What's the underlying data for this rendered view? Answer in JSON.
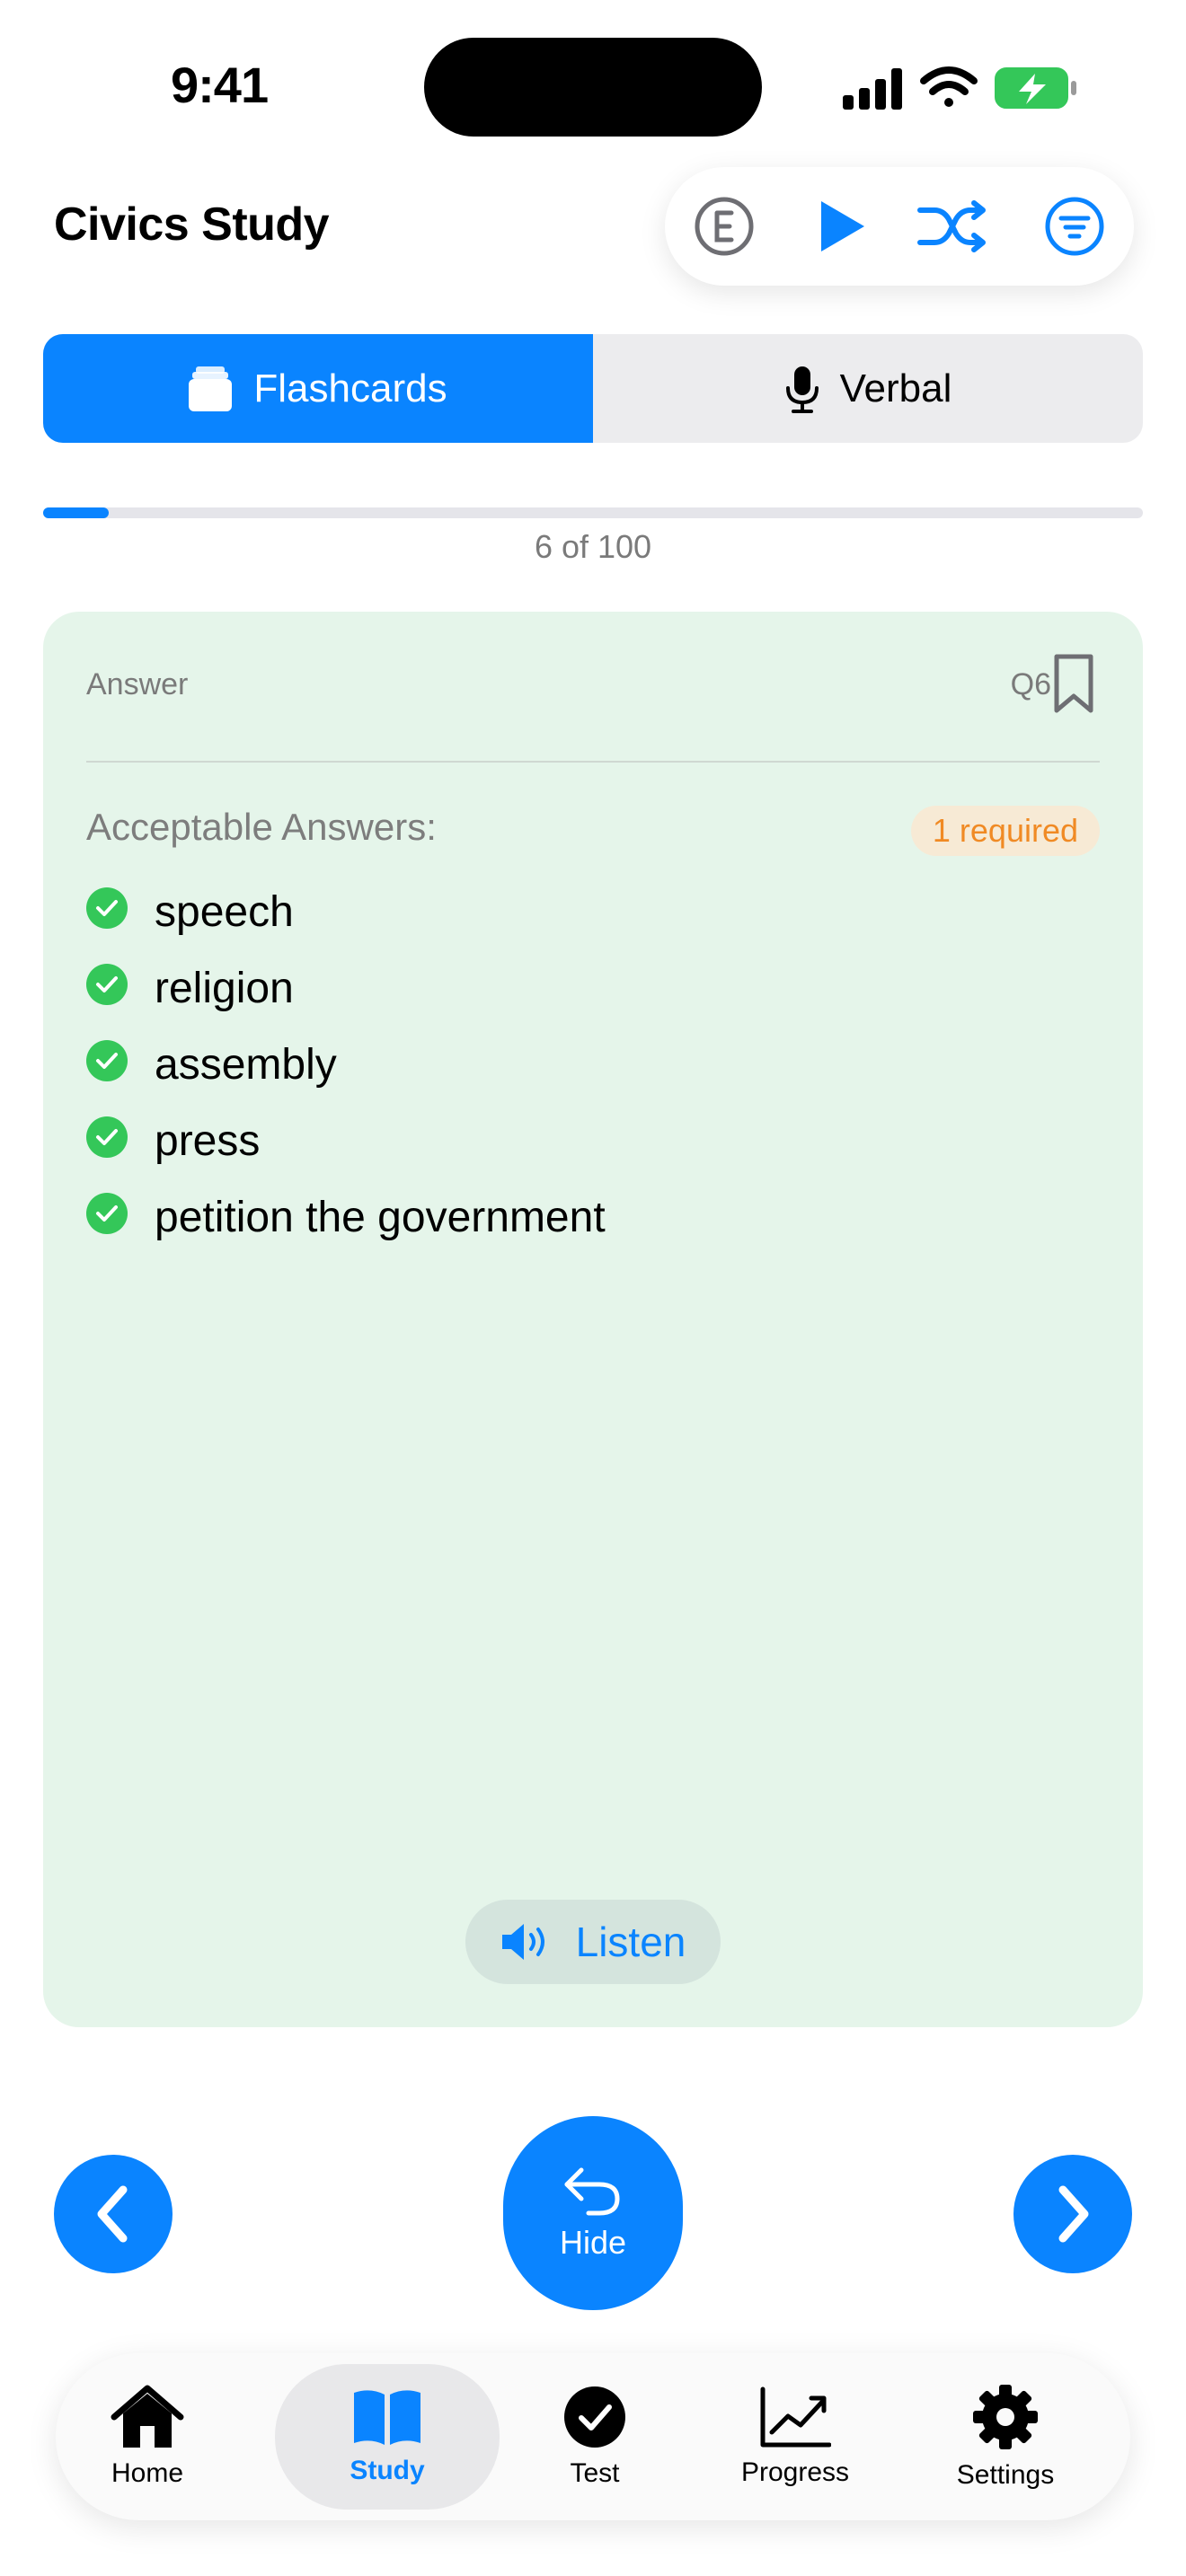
{
  "status_bar": {
    "time": "9:41"
  },
  "header": {
    "title": "Civics Study",
    "toolbar_icons": [
      "e-circle-icon",
      "play-icon",
      "shuffle-icon",
      "filter-icon"
    ]
  },
  "segmented": {
    "flashcards_label": "Flashcards",
    "verbal_label": "Verbal",
    "selected": "Flashcards"
  },
  "progress": {
    "text": "6 of 100",
    "current": 6,
    "total": 100
  },
  "card": {
    "label": "Answer",
    "question_number": "Q6",
    "answers_heading": "Acceptable Answers:",
    "required_badge": "1 required",
    "answers": [
      "speech",
      "religion",
      "assembly",
      "press",
      "petition the government"
    ],
    "listen_label": "Listen"
  },
  "controls": {
    "hide_label": "Hide"
  },
  "tabbar": {
    "items": [
      {
        "label": "Home"
      },
      {
        "label": "Study"
      },
      {
        "label": "Test"
      },
      {
        "label": "Progress"
      },
      {
        "label": "Settings"
      }
    ],
    "selected": "Study"
  },
  "colors": {
    "accent": "#0a84ff",
    "card_background": "#e5f5ea",
    "check_green": "#34c759",
    "badge_orange": "#f08a24"
  }
}
